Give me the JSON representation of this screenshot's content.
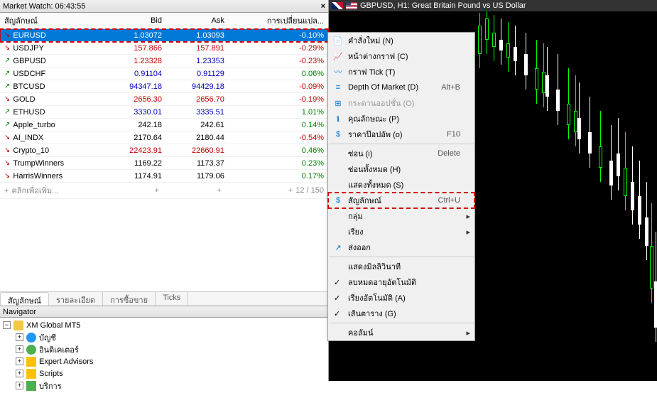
{
  "market_watch": {
    "title": "Market Watch: 06:43:55",
    "columns": {
      "symbol": "สัญลักษณ์",
      "bid": "Bid",
      "ask": "Ask",
      "change": "การเปลี่ยนแปล..."
    },
    "rows": [
      {
        "dir": "down",
        "symbol": "EURUSD",
        "bid": "1.03072",
        "ask": "1.03093",
        "change": "-0.10%",
        "sel": true,
        "bidc": "white",
        "askc": "white",
        "chc": "white"
      },
      {
        "dir": "down",
        "symbol": "USDJPY",
        "bid": "157.866",
        "ask": "157.891",
        "change": "-0.29%",
        "bidc": "red",
        "askc": "red",
        "chc": "red"
      },
      {
        "dir": "up",
        "symbol": "GBPUSD",
        "bid": "1.23328",
        "ask": "1.23353",
        "change": "-0.23%",
        "bidc": "red",
        "askc": "blue",
        "chc": "red"
      },
      {
        "dir": "up",
        "symbol": "USDCHF",
        "bid": "0.91104",
        "ask": "0.91129",
        "change": "0.06%",
        "bidc": "blue",
        "askc": "blue",
        "chc": "green"
      },
      {
        "dir": "up",
        "symbol": "BTCUSD",
        "bid": "94347.18",
        "ask": "94429.18",
        "change": "-0.09%",
        "bidc": "blue",
        "askc": "blue",
        "chc": "red"
      },
      {
        "dir": "down",
        "symbol": "GOLD",
        "bid": "2656.30",
        "ask": "2656.70",
        "change": "-0.19%",
        "bidc": "red",
        "askc": "red",
        "chc": "red"
      },
      {
        "dir": "up",
        "symbol": "ETHUSD",
        "bid": "3330.01",
        "ask": "3335.51",
        "change": "1.01%",
        "bidc": "blue",
        "askc": "blue",
        "chc": "green"
      },
      {
        "dir": "up",
        "symbol": "Apple_turbo",
        "bid": "242.18",
        "ask": "242.61",
        "change": "0.14%",
        "bidc": "black",
        "askc": "black",
        "chc": "green"
      },
      {
        "dir": "down",
        "symbol": "AI_INDX",
        "bid": "2170.64",
        "ask": "2180.44",
        "change": "-0.54%",
        "bidc": "black",
        "askc": "black",
        "chc": "red"
      },
      {
        "dir": "down",
        "symbol": "Crypto_10",
        "bid": "22423.91",
        "ask": "22660.91",
        "change": "0.46%",
        "bidc": "red",
        "askc": "red",
        "chc": "green"
      },
      {
        "dir": "down",
        "symbol": "TrumpWinners",
        "bid": "1169.22",
        "ask": "1173.37",
        "change": "0.23%",
        "bidc": "black",
        "askc": "black",
        "chc": "green"
      },
      {
        "dir": "down",
        "symbol": "HarrisWinners",
        "bid": "1174.91",
        "ask": "1179.06",
        "change": "0.17%",
        "bidc": "black",
        "askc": "black",
        "chc": "green"
      }
    ],
    "add_label": "คลิกเพื่อเพิ่ม...",
    "counter": "12 / 150",
    "tabs": [
      "สัญลักษณ์",
      "รายละเอียด",
      "การซื้อขาย",
      "Ticks"
    ]
  },
  "navigator": {
    "title": "Navigator",
    "root": "XM Global MT5",
    "items": [
      {
        "label": "บัญชี",
        "icon": "person"
      },
      {
        "label": "อินดิเคเตอร์",
        "icon": "green"
      },
      {
        "label": "Expert Advisors",
        "icon": "hat"
      },
      {
        "label": "Scripts",
        "icon": "script"
      },
      {
        "label": "บริการ",
        "icon": "book"
      }
    ]
  },
  "chart": {
    "title": "GBPUSD, H1: Great Britain Pound vs US Dollar"
  },
  "context_menu": {
    "items": [
      {
        "type": "item",
        "label": "คำสั่งใหม่ (N)",
        "icon": "order"
      },
      {
        "type": "item",
        "label": "หน้าต่างกราฟ (C)",
        "icon": "chart"
      },
      {
        "type": "item",
        "label": "กราฟ Tick (T)",
        "icon": "tick"
      },
      {
        "type": "item",
        "label": "Depth Of Market (D)",
        "shortcut": "Alt+B",
        "icon": "depth"
      },
      {
        "type": "item",
        "label": "กระดานออปชั่น (O)",
        "disabled": true,
        "icon": "board"
      },
      {
        "type": "item",
        "label": "คุณลักษณะ (P)",
        "icon": "prop"
      },
      {
        "type": "item",
        "label": "ราคาป๊อปอัพ (o)",
        "shortcut": "F10",
        "icon": "popup"
      },
      {
        "type": "sep"
      },
      {
        "type": "item",
        "label": "ซ่อน (i)",
        "shortcut": "Delete"
      },
      {
        "type": "item",
        "label": "ซ่อนทั้งหมด (H)"
      },
      {
        "type": "item",
        "label": "แสดงทั้งหมด (S)"
      },
      {
        "type": "item",
        "label": "สัญลักษณ์",
        "shortcut": "Ctrl+U",
        "icon": "symbol",
        "highlight": true
      },
      {
        "type": "item",
        "label": "กลุ่ม",
        "arrow": true
      },
      {
        "type": "item",
        "label": "เรียง",
        "arrow": true
      },
      {
        "type": "item",
        "label": "ส่งออก",
        "icon": "export"
      },
      {
        "type": "sep"
      },
      {
        "type": "item",
        "label": "แสดงมิลลิวินาที"
      },
      {
        "type": "item",
        "label": "ลบหมดอายุอัตโนมัติ",
        "check": true
      },
      {
        "type": "item",
        "label": "เรียงอัตโนมัติ (A)",
        "check": true
      },
      {
        "type": "item",
        "label": "เส้นตาราง (G)",
        "check": true
      },
      {
        "type": "sep"
      },
      {
        "type": "item",
        "label": "คอลัมน์",
        "arrow": true
      }
    ]
  }
}
